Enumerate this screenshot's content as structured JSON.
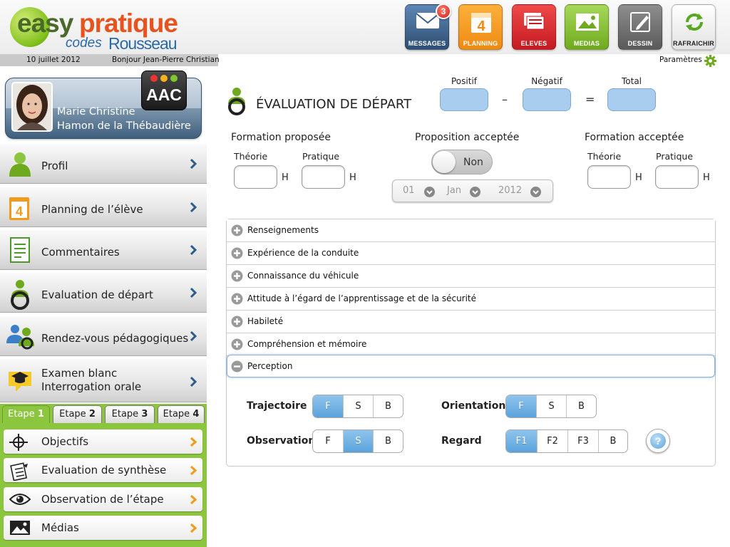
{
  "header": {
    "logo_easy": "easy",
    "logo_pratique": "pratique",
    "logo_codes": "codes",
    "logo_rousseau": "Rousseau",
    "date": "10 juillet 2012",
    "greeting": "Bonjour Jean-Pierre Christian",
    "settings_label": "Paramètres",
    "toolbar": [
      {
        "label": "MESSAGES",
        "icon": "envelope-icon",
        "color": "#3a5f8a",
        "badge": "3"
      },
      {
        "label": "PLANNING",
        "icon": "calendar-icon",
        "color": "#f29a1a"
      },
      {
        "label": "ELEVES",
        "icon": "students-icon",
        "color": "#d8242b"
      },
      {
        "label": "MEDIAS",
        "icon": "image-icon",
        "color": "#8cc63f"
      },
      {
        "label": "DESSIN",
        "icon": "pencil-icon",
        "color": "#7a7a7a"
      },
      {
        "label": "RAFRAICHIR",
        "icon": "refresh-icon",
        "color": "#f4f4f4"
      }
    ]
  },
  "profile": {
    "first_line": "Marie Christine",
    "second_line": "Hamon de la Thébaudière",
    "badge": "AAC"
  },
  "nav": [
    {
      "label": "Profil",
      "icon": "person-icon"
    },
    {
      "label": "Planning de l’élève",
      "icon": "calendar-icon"
    },
    {
      "label": "Commentaires",
      "icon": "document-icon"
    },
    {
      "label": "Evaluation de départ",
      "icon": "steering-wheel-person-icon"
    },
    {
      "label": "Rendez-vous pédagogiques",
      "icon": "people-icon"
    },
    {
      "label": "Examen blanc",
      "label2": "Interrogation orale",
      "icon": "graduation-cap-icon"
    }
  ],
  "steps": {
    "tabs": [
      {
        "label": "Etape",
        "num": "1"
      },
      {
        "label": "Etape",
        "num": "2"
      },
      {
        "label": "Etape",
        "num": "3"
      },
      {
        "label": "Etape",
        "num": "4"
      }
    ],
    "active": "1",
    "items": [
      {
        "label": "Objectifs",
        "icon": "target-icon"
      },
      {
        "label": "Evaluation de synthèse",
        "icon": "notepad-icon"
      },
      {
        "label": "Observation de l’étape",
        "icon": "eye-icon"
      },
      {
        "label": "Médias",
        "icon": "image-icon"
      }
    ]
  },
  "main": {
    "title": "ÉVALUATION DE DÉPART",
    "score": {
      "positive_label": "Positif",
      "negative_label": "Négatif",
      "total_label": "Total",
      "minus": "–",
      "equals": "="
    },
    "formation_proposee": {
      "title": "Formation proposée",
      "theory": "Théorie",
      "practice": "Pratique",
      "unit": "H"
    },
    "proposition": {
      "title": "Proposition acceptée",
      "toggle": "Non",
      "day": "01",
      "month": "Jan",
      "year": "2012"
    },
    "formation_acceptee": {
      "title": "Formation acceptée",
      "theory": "Théorie",
      "practice": "Pratique",
      "unit": "H"
    },
    "sections": [
      "Renseignements",
      "Expérience de la conduite",
      "Connaissance du véhicule",
      "Attitude à l’égard de l’apprentissage et de la sécurité",
      "Habileté",
      "Compréhension et mémoire"
    ],
    "open_section": "Perception",
    "perception": {
      "trajectoire": {
        "label": "Trajectoire",
        "options": [
          "F",
          "S",
          "B"
        ],
        "selected": "F"
      },
      "orientation": {
        "label": "Orientation",
        "options": [
          "F",
          "S",
          "B"
        ],
        "selected": "F"
      },
      "observation": {
        "label": "Observation",
        "options": [
          "F",
          "S",
          "B"
        ],
        "selected": "S"
      },
      "regard": {
        "label": "Regard",
        "options": [
          "F1",
          "F2",
          "F3",
          "B"
        ],
        "selected": "F1"
      },
      "help": "?"
    }
  }
}
